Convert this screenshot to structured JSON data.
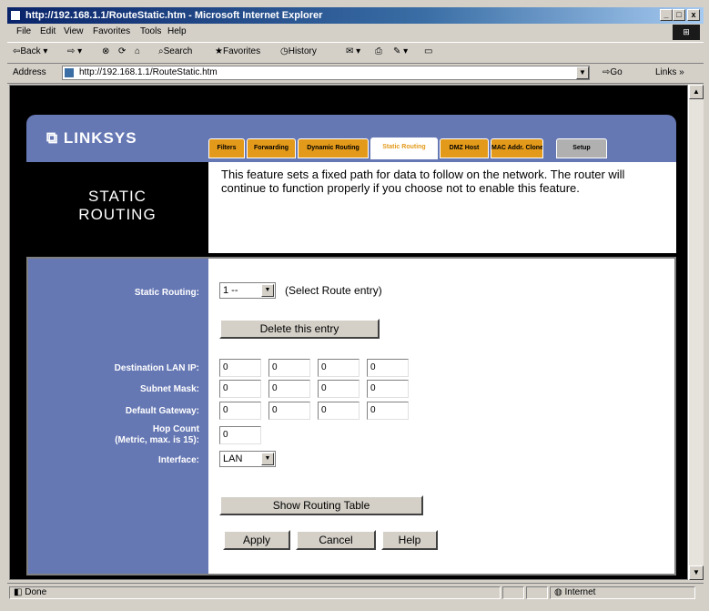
{
  "window": {
    "title": "http://192.168.1.1/RouteStatic.htm - Microsoft Internet Explorer",
    "min": "_",
    "max": "□",
    "close": "x"
  },
  "menu": [
    "File",
    "Edit",
    "View",
    "Favorites",
    "Tools",
    "Help"
  ],
  "toolbar": {
    "back": "Back",
    "search": "Search",
    "favorites": "Favorites",
    "history": "History"
  },
  "address": {
    "label": "Address",
    "url": "http://192.168.1.1/RouteStatic.htm",
    "go": "Go",
    "links": "Links"
  },
  "status": {
    "left": "Done",
    "zone": "Internet"
  },
  "router": {
    "logo": "LINKSYS",
    "tabs": [
      "Filters",
      "Forwarding",
      "Dynamic Routing",
      "Static Routing",
      "DMZ Host",
      "MAC Addr. Clone",
      "Setup"
    ],
    "title_line1": "STATIC",
    "title_line2": "ROUTING",
    "description": "This feature sets a fixed path for data to follow on the network. The router will continue to function properly if you choose not to enable this feature.",
    "static_routing_label": "Static Routing:",
    "route_entry": "1 --",
    "route_entry_hint": "(Select Route entry)",
    "delete_btn": "Delete this entry",
    "dest_label": "Destination LAN IP:",
    "subnet_label": "Subnet Mask:",
    "gateway_label": "Default Gateway:",
    "hop_label1": "Hop Count",
    "hop_label2": "(Metric, max. is 15):",
    "interface_label": "Interface:",
    "dest_ip": [
      "0",
      "0",
      "0",
      "0"
    ],
    "subnet": [
      "0",
      "0",
      "0",
      "0"
    ],
    "gateway": [
      "0",
      "0",
      "0",
      "0"
    ],
    "hop": "0",
    "interface": "LAN",
    "show_table_btn": "Show Routing Table",
    "apply_btn": "Apply",
    "cancel_btn": "Cancel",
    "help_btn": "Help"
  }
}
